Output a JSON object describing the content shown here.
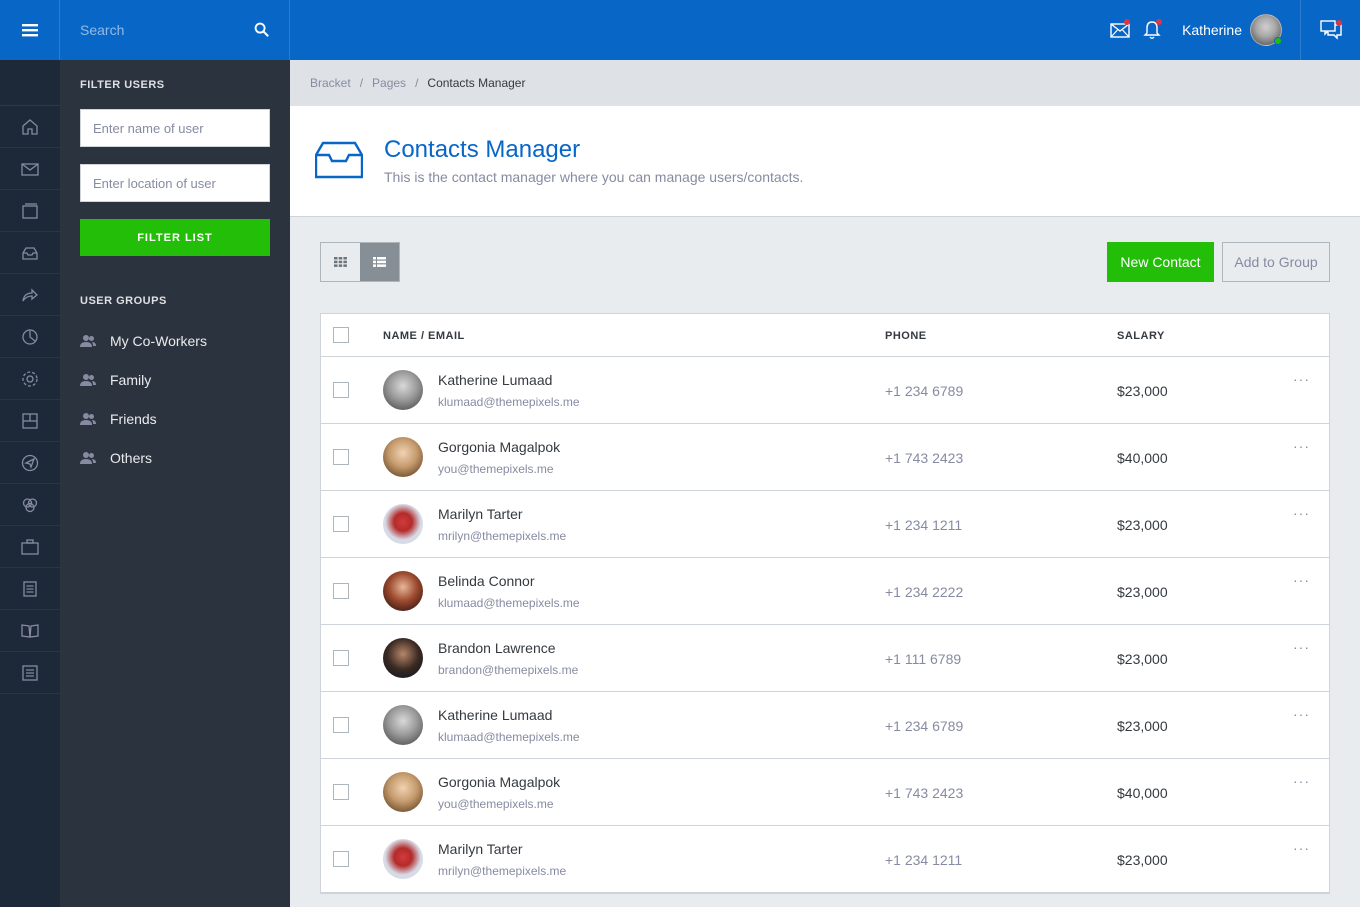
{
  "header": {
    "search_placeholder": "Search",
    "user_name": "Katherine",
    "colors": {
      "primary": "#0866c6",
      "notification": "#dc3545",
      "online": "#23bf08"
    }
  },
  "sidebar": {
    "filter_title": "FILTER USERS",
    "name_placeholder": "Enter name of user",
    "location_placeholder": "Enter location of user",
    "filter_button": "FILTER LIST",
    "groups_title": "USER GROUPS",
    "groups": [
      {
        "label": "My Co-Workers",
        "icon": "users-icon"
      },
      {
        "label": "Family",
        "icon": "users-icon"
      },
      {
        "label": "Friends",
        "icon": "users-icon"
      },
      {
        "label": "Others",
        "icon": "users-icon"
      }
    ]
  },
  "rail_icons": [
    "home-icon",
    "mail-icon",
    "pages-icon",
    "inbox-icon",
    "share-icon",
    "chart-icon",
    "settings-icon",
    "layout-icon",
    "navigation-icon",
    "circles-icon",
    "briefcase-icon",
    "document-icon",
    "book-icon",
    "list-icon"
  ],
  "breadcrumb": {
    "items": [
      "Bracket",
      "Pages"
    ],
    "active": "Contacts Manager"
  },
  "page": {
    "title": "Contacts Manager",
    "subtitle": "This is the contact manager where you can manage users/contacts.",
    "new_contact": "New Contact",
    "add_to_group": "Add to Group"
  },
  "table": {
    "columns": [
      "NAME / EMAIL",
      "PHONE",
      "SALARY"
    ],
    "rows": [
      {
        "name": "Katherine Lumaad",
        "email": "klumaad@themepixels.me",
        "phone": "+1 234 6789",
        "salary": "$23,000",
        "more": "···"
      },
      {
        "name": "Gorgonia Magalpok",
        "email": "you@themepixels.me",
        "phone": "+1 743 2423",
        "salary": "$40,000",
        "more": "···"
      },
      {
        "name": "Marilyn Tarter",
        "email": "mrilyn@themepixels.me",
        "phone": "+1 234 1211",
        "salary": "$23,000",
        "more": "···"
      },
      {
        "name": "Belinda Connor",
        "email": "klumaad@themepixels.me",
        "phone": "+1 234 2222",
        "salary": "$23,000",
        "more": "···"
      },
      {
        "name": "Brandon Lawrence",
        "email": "brandon@themepixels.me",
        "phone": "+1 111 6789",
        "salary": "$23,000",
        "more": "···"
      },
      {
        "name": "Katherine Lumaad",
        "email": "klumaad@themepixels.me",
        "phone": "+1 234 6789",
        "salary": "$23,000",
        "more": "···"
      },
      {
        "name": "Gorgonia Magalpok",
        "email": "you@themepixels.me",
        "phone": "+1 743 2423",
        "salary": "$40,000",
        "more": "···"
      },
      {
        "name": "Marilyn Tarter",
        "email": "mrilyn@themepixels.me",
        "phone": "+1 234 1211",
        "salary": "$23,000",
        "more": "···"
      }
    ]
  }
}
